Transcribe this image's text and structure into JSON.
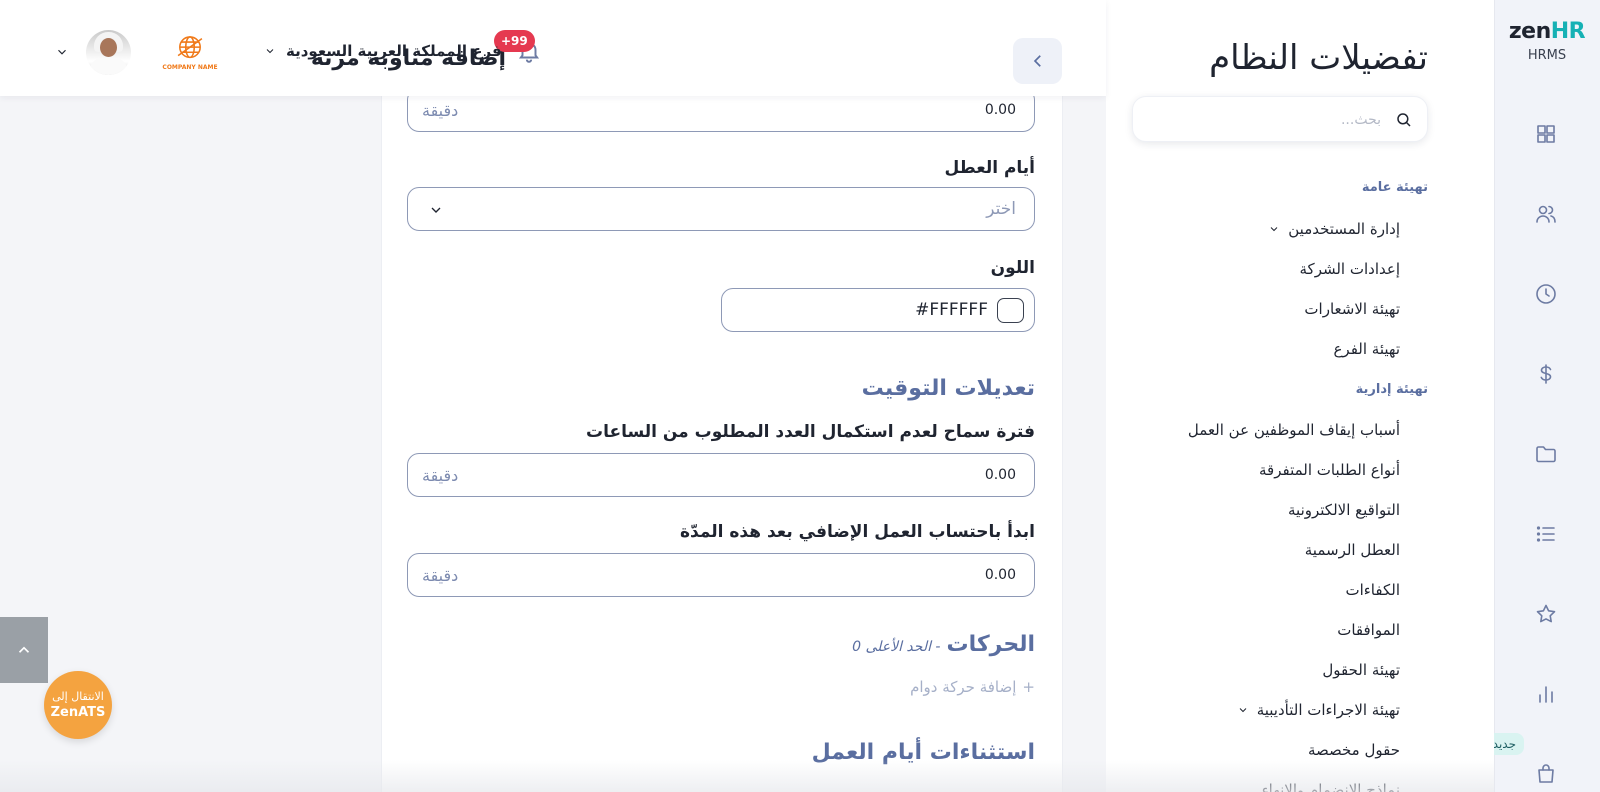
{
  "app": {
    "logo_main": "zen",
    "logo_accent": "HR",
    "logo_sub": "HRMS"
  },
  "rail": {
    "icons": [
      "dashboard-icon",
      "users-icon",
      "clock-icon",
      "dollar-icon",
      "folder-icon",
      "list-icon",
      "star-icon",
      "chart-icon",
      "bag-icon"
    ],
    "new_badge": "جديد"
  },
  "settings": {
    "title": "تفضيلات النظام",
    "search_placeholder": "بحث...",
    "sections": [
      {
        "label": "تهيئة عامة"
      },
      {
        "label": "تهيئة إدارية"
      }
    ],
    "items": [
      {
        "label": "إدارة المستخدمين",
        "expandable": true
      },
      {
        "label": "إعدادات الشركة"
      },
      {
        "label": "تهيئة الاشعارات"
      },
      {
        "label": "تهيئة الفرع"
      },
      {
        "label": "أسباب إيقاف الموظفين عن العمل"
      },
      {
        "label": "أنواع الطلبات المتفرقة"
      },
      {
        "label": "التواقيع الالكترونية"
      },
      {
        "label": "العطل الرسمية"
      },
      {
        "label": "الكفاءات"
      },
      {
        "label": "الموافقات"
      },
      {
        "label": "تهيئة الحقول"
      },
      {
        "label": "تهيئة الاجراءات التأديبية",
        "expandable": true
      },
      {
        "label": "حقول مخصصة"
      },
      {
        "label": "نماذج الانضمام والانهاء"
      }
    ]
  },
  "header": {
    "page_title": "إضافة مناوبة مرنة",
    "notification_count": "+99",
    "branch": "فرع المملكة العربية السعودية",
    "company_logo_text": "COMPANY NAME"
  },
  "form": {
    "top_field": {
      "value": "0.00",
      "unit": "دقيقة"
    },
    "holidays": {
      "label": "أيام العطل",
      "placeholder": "اختر"
    },
    "color": {
      "label": "اللون",
      "value": "#FFFFFF",
      "swatch": "#ffffff"
    },
    "time_adjustments": {
      "heading": "تعديلات التوقيت",
      "grace": {
        "label": "فترة سماح لعدم استكمال العدد المطلوب من الساعات",
        "value": "0.00",
        "unit": "دقيقة"
      },
      "overtime": {
        "label": "ابدأ باحتساب العمل الإضافي بعد هذه المدّة",
        "value": "0.00",
        "unit": "دقيقة"
      }
    },
    "moves": {
      "heading": "الحركات",
      "sub": "- الحد الأعلى 0",
      "add_label": "إضافة حركة دوام"
    },
    "exceptions": {
      "heading": "استثناءات أيام العمل"
    }
  },
  "floating": {
    "zenats_line1": "الانتقال إلى",
    "zenats_line2": "ZenATS"
  },
  "colors": {
    "accent": "#5a6ea0",
    "brand_teal": "#16b1b5",
    "badge_red": "#e53950",
    "zenats_orange": "#f4a340"
  }
}
